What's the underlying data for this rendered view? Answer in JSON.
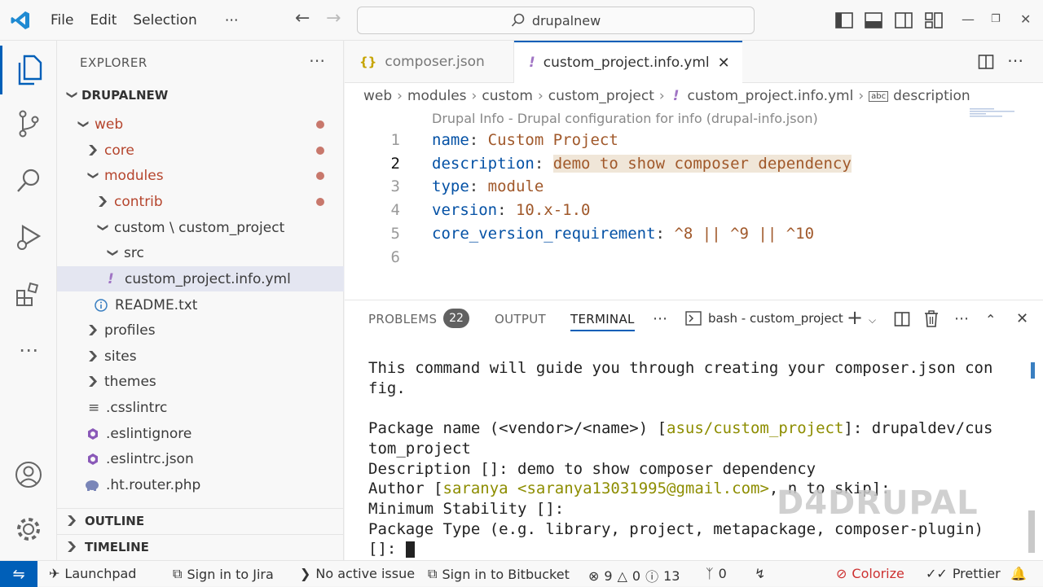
{
  "titlebar": {
    "menu": [
      "File",
      "Edit",
      "Selection",
      "⋯"
    ],
    "search": "drupalnew"
  },
  "sidebar": {
    "title": "EXPLORER",
    "more": "⋯",
    "root": "DRUPALNEW",
    "items": [
      {
        "label": "web"
      },
      {
        "label": "core"
      },
      {
        "label": "modules"
      },
      {
        "label": "contrib"
      },
      {
        "label": "custom \\ custom_project"
      },
      {
        "label": "src"
      },
      {
        "label": "custom_project.info.yml"
      },
      {
        "label": "README.txt"
      },
      {
        "label": "profiles"
      },
      {
        "label": "sites"
      },
      {
        "label": "themes"
      },
      {
        "label": ".csslintrc"
      },
      {
        "label": ".eslintignore"
      },
      {
        "label": ".eslintrc.json"
      },
      {
        "label": ".ht.router.php"
      }
    ],
    "outline": "OUTLINE",
    "timeline": "TIMELINE"
  },
  "tabs": [
    {
      "label": "composer.json",
      "icon": "{}"
    },
    {
      "label": "custom_project.info.yml",
      "icon": "!"
    }
  ],
  "breadcrumb": [
    "web",
    "modules",
    "custom",
    "custom_project",
    "custom_project.info.yml",
    "description"
  ],
  "editor": {
    "codelens": "Drupal Info - Drupal configuration for info (drupal-info.json)",
    "line_numbers": [
      "1",
      "2",
      "3",
      "4",
      "5",
      "6"
    ],
    "lines": [
      {
        "key": "name",
        "value": "Custom Project"
      },
      {
        "key": "description",
        "value": "demo to show composer dependency"
      },
      {
        "key": "type",
        "value": "module"
      },
      {
        "key": "version",
        "value": "10.x-1.0"
      },
      {
        "key": "core_version_requirement",
        "value": "^8 || ^9 || ^10"
      }
    ]
  },
  "panel": {
    "tabs": [
      "PROBLEMS",
      "OUTPUT",
      "TERMINAL"
    ],
    "problems_count": "22",
    "terminal_name": "bash - custom_project",
    "terminal": {
      "l1": "This command will guide you through creating your composer.json con",
      "l2": "fig.",
      "l3a": "Package name (<vendor>/<name>) [",
      "l3b": "asus/custom_project",
      "l3c": "]: drupaldev/cus",
      "l4": "tom_project",
      "l5": "Description []: demo to show composer dependency",
      "l6a": "Author [",
      "l6b": "saranya <saranya13031995@gmail.com>",
      "l6c": ", n to skip]:",
      "l7": "Minimum Stability []:",
      "l8": "Package Type (e.g. library, project, metapackage, composer-plugin)",
      "l9": "[]: "
    },
    "watermark": "D4DRUPAL"
  },
  "statusbar": {
    "launchpad": "Launchpad",
    "jira": "Sign in to Jira",
    "issue": "No active issue",
    "bitbucket": "Sign in to Bitbucket",
    "errors": "9",
    "warnings": "0",
    "infos": "13",
    "ports": "0",
    "colorize": "Colorize",
    "prettier": "Prettier"
  },
  "colors": {
    "accent": "#005fb8",
    "modified": "#b5452d"
  }
}
